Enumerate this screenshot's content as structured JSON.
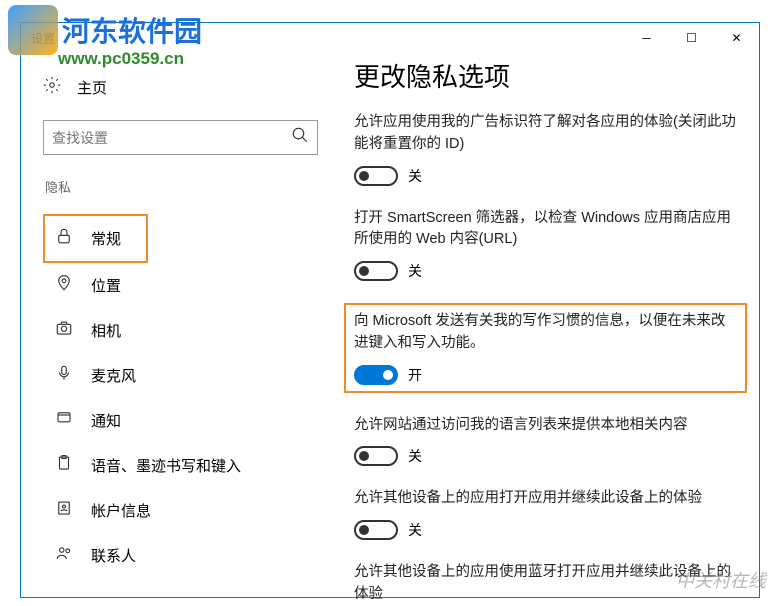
{
  "watermark": {
    "site_name": "河东软件园",
    "url": "www.pc0359.cn",
    "bottom": "中关村在线"
  },
  "window": {
    "title": "设置"
  },
  "sidebar": {
    "home": "主页",
    "search_placeholder": "查找设置",
    "section": "隐私",
    "items": [
      {
        "label": "常规"
      },
      {
        "label": "位置"
      },
      {
        "label": "相机"
      },
      {
        "label": "麦克风"
      },
      {
        "label": "通知"
      },
      {
        "label": "语音、墨迹书写和键入"
      },
      {
        "label": "帐户信息"
      },
      {
        "label": "联系人"
      }
    ]
  },
  "main": {
    "title": "更改隐私选项",
    "settings": [
      {
        "desc": "允许应用使用我的广告标识符了解对各应用的体验(关闭此功能将重置你的 ID)",
        "state": "关"
      },
      {
        "desc": "打开 SmartScreen 筛选器，以检查 Windows 应用商店应用所使用的 Web 内容(URL)",
        "state": "关"
      },
      {
        "desc": "向 Microsoft 发送有关我的写作习惯的信息，以便在未来改进键入和写入功能。",
        "state": "开"
      },
      {
        "desc": "允许网站通过访问我的语言列表来提供本地相关内容",
        "state": "关"
      },
      {
        "desc": "允许其他设备上的应用打开应用并继续此设备上的体验",
        "state": "关"
      },
      {
        "desc": "允许其他设备上的应用使用蓝牙打开应用并继续此设备上的体验",
        "state": ""
      }
    ]
  }
}
